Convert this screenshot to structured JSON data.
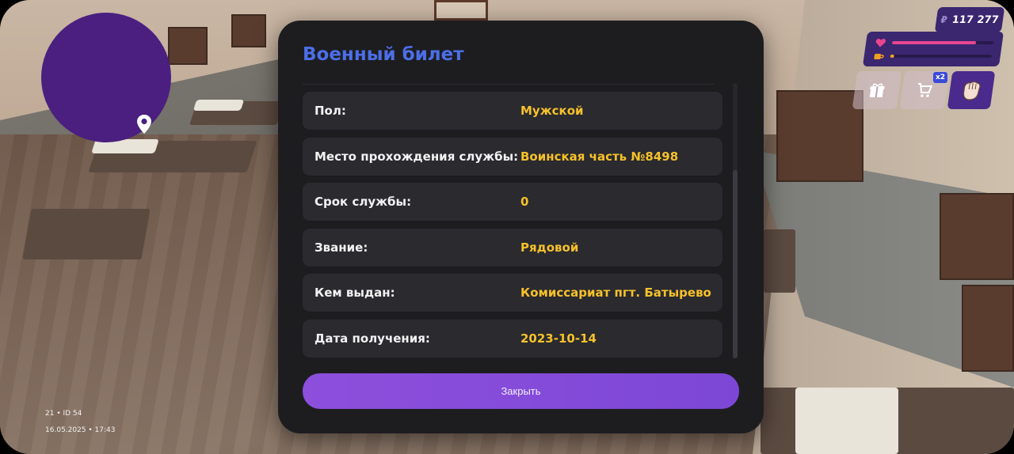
{
  "hud": {
    "money_currency": "₽",
    "money_value": "117 277",
    "health_fraction": 0.83,
    "hunger_fraction": 0.04,
    "shop_badge": "x2",
    "health_color": "#e8468f",
    "hunger_color": "#f0a020"
  },
  "debug": {
    "line1": "21 • ID 54",
    "line2": "16.05.2025 • 17:43"
  },
  "modal": {
    "title": "Военный билет",
    "rows": [
      {
        "label": "Пол:",
        "value": "Мужской"
      },
      {
        "label": "Место прохождения службы:",
        "value": "Воинская часть №8498"
      },
      {
        "label": "Срок службы:",
        "value": "0"
      },
      {
        "label": "Звание:",
        "value": "Рядовой"
      },
      {
        "label": "Кем выдан:",
        "value": "Комиссариат пгт. Батырево"
      },
      {
        "label": "Дата получения:",
        "value": "2023-10-14"
      }
    ],
    "close_label": "Закрыть",
    "title_color": "#4c6ee8",
    "value_color": "#f6c12a",
    "button_color": "#8d4fdc"
  },
  "icons": {
    "map_pin": "map-pin-icon",
    "heart": "heart-icon",
    "food": "food-icon",
    "gift": "gift-icon",
    "cart": "cart-icon",
    "fist": "fist-icon"
  }
}
